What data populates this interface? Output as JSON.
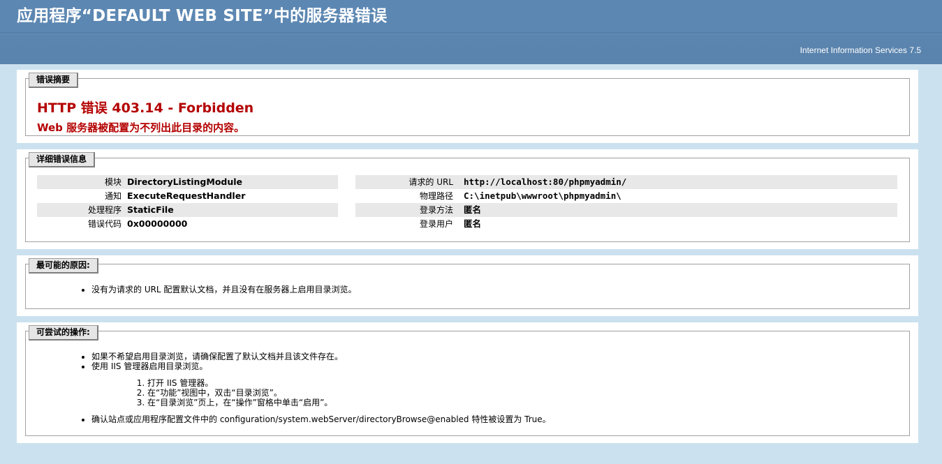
{
  "header": {
    "title": "应用程序“DEFAULT WEB SITE”中的服务器错误",
    "server_version": "Internet Information Services 7.5"
  },
  "summary": {
    "legend": "错误摘要",
    "error_title": "HTTP 错误 403.14 - Forbidden",
    "error_desc": "Web 服务器被配置为不列出此目录的内容。"
  },
  "details": {
    "legend": "详细错误信息",
    "left": [
      {
        "label": "模块",
        "value": "DirectoryListingModule"
      },
      {
        "label": "通知",
        "value": "ExecuteRequestHandler"
      },
      {
        "label": "处理程序",
        "value": "StaticFile"
      },
      {
        "label": "错误代码",
        "value": "0x00000000"
      }
    ],
    "right": [
      {
        "label": "请求的 URL",
        "value": "http://localhost:80/phpmyadmin/"
      },
      {
        "label": "物理路径",
        "value": "C:\\inetpub\\wwwroot\\phpmyadmin\\"
      },
      {
        "label": "登录方法",
        "value": "匿名"
      },
      {
        "label": "登录用户",
        "value": "匿名"
      }
    ]
  },
  "causes": {
    "legend": "最可能的原因:",
    "items": [
      "没有为请求的 URL 配置默认文档，并且没有在服务器上启用目录浏览。"
    ]
  },
  "actions": {
    "legend": "可尝试的操作:",
    "items": [
      "如果不希望启用目录浏览，请确保配置了默认文档并且该文件存在。",
      "使用 IIS 管理器启用目录浏览。"
    ],
    "steps": [
      "打开 IIS 管理器。",
      "在“功能”视图中，双击“目录浏览”。",
      "在“目录浏览”页上，在“操作”窗格中单击“启用”。"
    ],
    "final_item": "确认站点或应用程序配置文件中的 configuration/system.webServer/directoryBrowse@enabled 特性被设置为 True。"
  }
}
